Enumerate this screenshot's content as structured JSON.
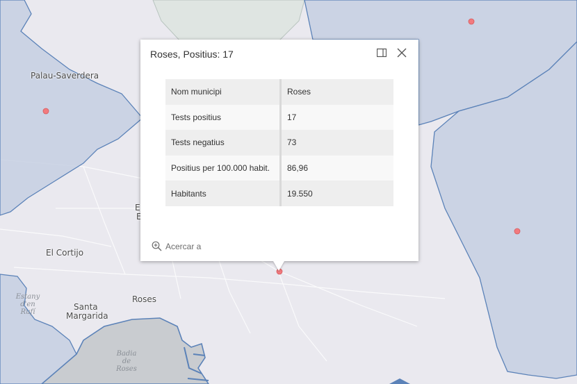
{
  "map": {
    "place_labels": [
      {
        "name": "Palau-Saverdera"
      },
      {
        "name": "El Cortijo"
      },
      {
        "name": "Santa"
      },
      {
        "name": "Margarida"
      },
      {
        "name": "Roses"
      },
      {
        "name": "El"
      },
      {
        "name": "E"
      }
    ],
    "water_labels": [
      {
        "lines": [
          "Estany",
          "d'en",
          "Rufí"
        ]
      },
      {
        "lines": [
          "Badia",
          "de",
          "Roses"
        ]
      }
    ],
    "colors": {
      "base_land": "#eae9ef",
      "polygon_fill": "#c6cfe2",
      "polygon_stroke": "#5b82b8",
      "green_area": "#dfe5e2",
      "sea": "#c9ccd0",
      "point_marker": "#f27a7e"
    }
  },
  "popup": {
    "title": "Roses, Positius: 17",
    "dock_icon": "dock-icon",
    "close_icon": "close-icon",
    "rows": [
      {
        "key": "Nom municipi",
        "value": "Roses"
      },
      {
        "key": "Tests positius",
        "value": "17"
      },
      {
        "key": "Tests negatius",
        "value": "73"
      },
      {
        "key": "Positius per 100.000 habit.",
        "value": "86,96"
      },
      {
        "key": "Habitants",
        "value": "19.550"
      }
    ],
    "zoom_label": "Acercar a",
    "zoom_icon": "zoom-in-icon"
  }
}
